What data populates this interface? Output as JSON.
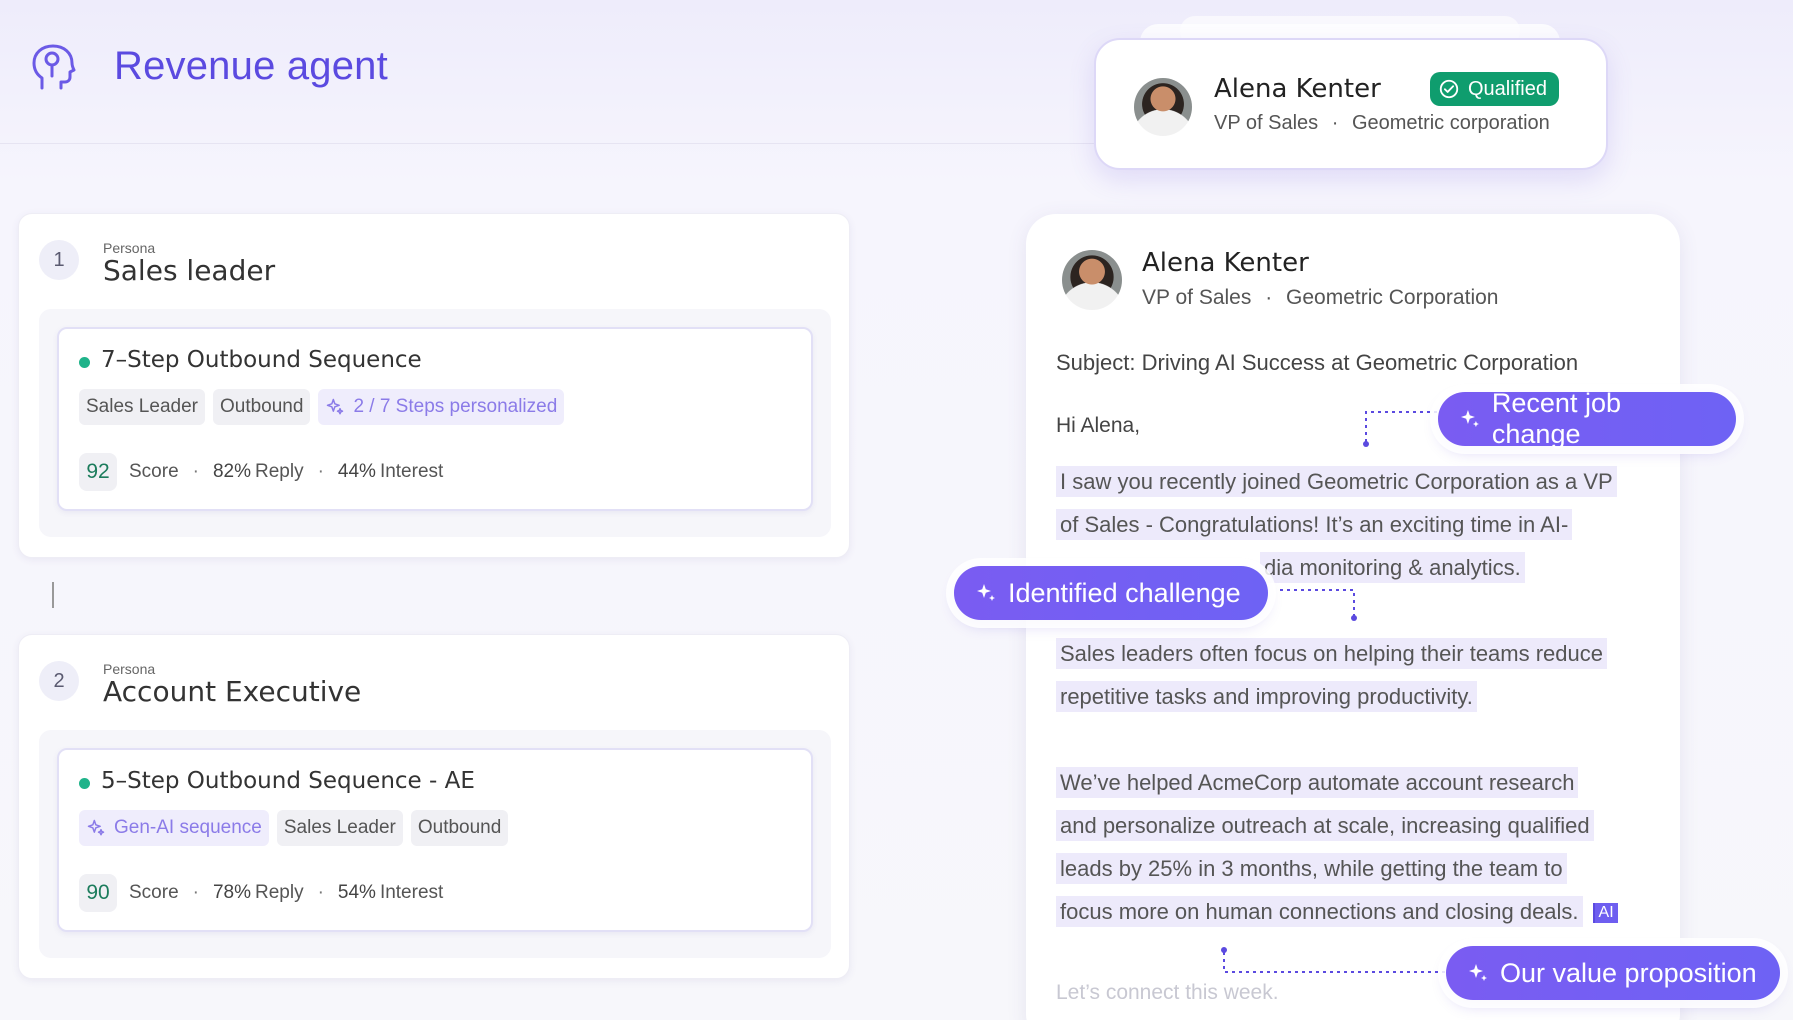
{
  "header": {
    "title": "Revenue agent",
    "logo_icon": "head-circuit-icon"
  },
  "personas": [
    {
      "number": "1",
      "kicker": "Persona",
      "name": "Sales leader",
      "sequence": {
        "title": "7–Step Outbound Sequence",
        "tags": [
          "Sales Leader",
          "Outbound"
        ],
        "ai_tag": "2 / 7  Steps personalized",
        "score": "92",
        "score_label": "Score",
        "reply_value": "82%",
        "reply_label": "Reply",
        "interest_value": "44%",
        "interest_label": "Interest"
      }
    },
    {
      "number": "2",
      "kicker": "Persona",
      "name": "Account Executive",
      "sequence": {
        "title": "5–Step Outbound Sequence - AE",
        "ai_tag": "Gen-AI sequence",
        "tags": [
          "Sales Leader",
          "Outbound"
        ],
        "score": "90",
        "score_label": "Score",
        "reply_value": "78%",
        "reply_label": "Reply",
        "interest_value": "54%",
        "interest_label": "Interest"
      }
    }
  ],
  "top_contact": {
    "name": "Alena Kenter",
    "badge": "Qualified",
    "title": "VP of Sales",
    "separator": "·",
    "company": "Geometric corporation"
  },
  "email": {
    "name": "Alena Kenter",
    "title": "VP of Sales",
    "separator": "·",
    "company": "Geometric Corporation",
    "subject_label": "Subject:",
    "subject": "Driving AI Success at Geometric Corporation",
    "greeting": "Hi Alena,",
    "para1_line1": "I saw you recently joined Geometric Corporation as a VP",
    "para1_line2": "of Sales - Congratulations! It’s an exciting time in AI-",
    "para1_line3": "dia monitoring & analytics.",
    "para2_line1": "Sales leaders often focus on helping their teams reduce",
    "para2_line2": "repetitive tasks and improving productivity.",
    "para3_line1": "We’ve helped AcmeCorp automate account research",
    "para3_line2": "and personalize outreach at scale, increasing qualified",
    "para3_line3": "leads by 25% in 3 months, while getting the team to",
    "para3_line4": "focus more on human connections and closing deals.",
    "ai_badge": "AI",
    "closing": "Let’s connect this week."
  },
  "callouts": {
    "job_change": "Recent job change",
    "challenge": "Identified challenge",
    "value_prop": "Our value proposition"
  },
  "colors": {
    "brand": "#5b4ae0",
    "callout": "#7a5cf2",
    "qualified": "#0f9d6e",
    "status_dot": "#1fb38a",
    "highlight": "#edeafb"
  }
}
